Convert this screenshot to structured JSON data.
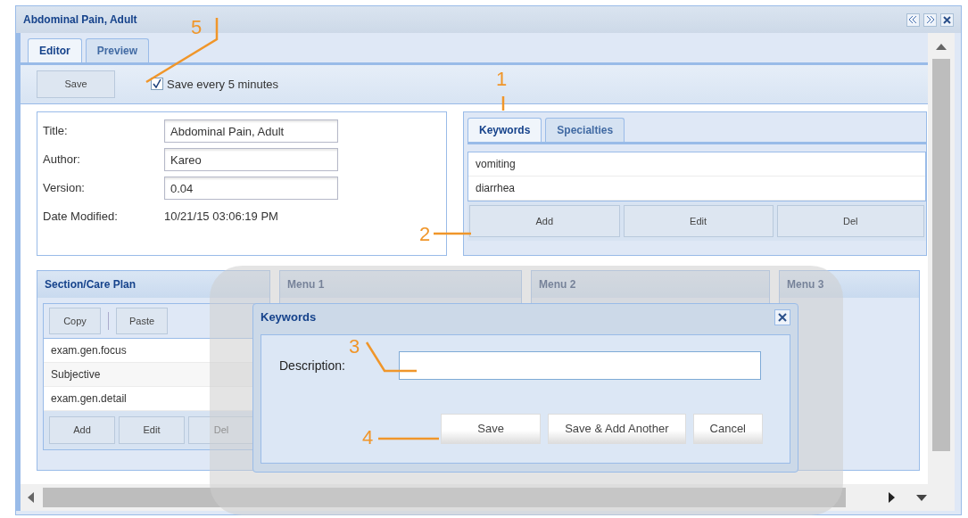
{
  "window": {
    "title": "Abdominal Pain, Adult"
  },
  "tabs": [
    {
      "label": "Editor",
      "selected": true
    },
    {
      "label": "Preview",
      "selected": false
    }
  ],
  "toolbar": {
    "save_button": "Save",
    "autosave": {
      "label": "Save every 5 minutes",
      "checked": true
    }
  },
  "form": {
    "fields": [
      {
        "label": "Title:",
        "value": "Abdominal Pain, Adult",
        "kind": "input"
      },
      {
        "label": "Author:",
        "value": "Kareo",
        "kind": "input"
      },
      {
        "label": "Version:",
        "value": "0.04",
        "kind": "input"
      },
      {
        "label": "Date Modified:",
        "value": "10/21/15 03:06:19 PM",
        "kind": "text"
      }
    ]
  },
  "keywords_panel": {
    "tabs": [
      {
        "label": "Keywords",
        "selected": true
      },
      {
        "label": "Specialties",
        "selected": false
      }
    ],
    "items": [
      "vomiting",
      "diarrhea"
    ],
    "buttons": [
      "Add",
      "Edit",
      "Del"
    ]
  },
  "section_panel": {
    "title": "Section/Care Plan",
    "toolbar": [
      "Copy",
      "Paste"
    ],
    "items": [
      "exam.gen.focus",
      "Subjective",
      "exam.gen.detail"
    ],
    "buttons": [
      "Add",
      "Edit",
      "Del"
    ]
  },
  "menu_panels": [
    {
      "title": "Menu 1"
    },
    {
      "title": "Menu 2"
    },
    {
      "title": "Menu 3"
    }
  ],
  "dialog": {
    "title": "Keywords",
    "field_label": "Description:",
    "buttons": [
      "Save",
      "Save & Add Another",
      "Cancel"
    ]
  },
  "callouts": [
    "1",
    "2",
    "3",
    "4",
    "5"
  ]
}
